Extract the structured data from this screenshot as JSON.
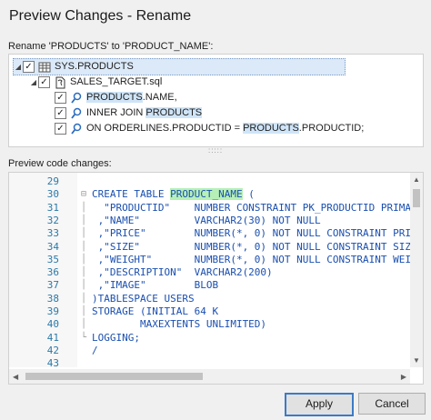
{
  "dialog": {
    "title": "Preview Changes - Rename",
    "rename_label": "Rename 'PRODUCTS' to 'PRODUCT_NAME':",
    "preview_label": "Preview code changes:"
  },
  "tree": {
    "root": {
      "label": "SYS.PRODUCTS",
      "checked": true,
      "icon": "table-icon"
    },
    "file": {
      "label": "SALES_TARGET.sql",
      "checked": true,
      "icon": "sql-file-icon"
    },
    "items": [
      {
        "pre": "",
        "match": "PRODUCTS",
        "post": ".NAME,",
        "checked": true,
        "icon": "find-reference-icon"
      },
      {
        "pre": "INNER JOIN ",
        "match": "PRODUCTS",
        "post": "",
        "checked": true,
        "icon": "find-reference-icon"
      },
      {
        "pre": "ON ORDERLINES.PRODUCTID = ",
        "match": "PRODUCTS",
        "post": ".PRODUCTID;",
        "checked": true,
        "icon": "find-reference-icon"
      }
    ]
  },
  "code": {
    "line_numbers": [
      "29",
      "30",
      "31",
      "32",
      "33",
      "34",
      "35",
      "36",
      "37",
      "38",
      "39",
      "40",
      "41",
      "42",
      "43"
    ],
    "lines": [
      "",
      "CREATE TABLE PRODUCT_NAME (",
      "  \"PRODUCTID\"    NUMBER CONSTRAINT PK_PRODUCTID PRIMA",
      " ,\"NAME\"         VARCHAR2(30) NOT NULL",
      " ,\"PRICE\"        NUMBER(*, 0) NOT NULL CONSTRAINT PRI",
      " ,\"SIZE\"         NUMBER(*, 0) NOT NULL CONSTRAINT SIZ",
      " ,\"WEIGHT\"       NUMBER(*, 0) NOT NULL CONSTRAINT WEI",
      " ,\"DESCRIPTION\"  VARCHAR2(200)",
      " ,\"IMAGE\"        BLOB",
      ")TABLESPACE USERS",
      "STORAGE (INITIAL 64 K",
      "        MAXEXTENTS UNLIMITED)",
      "LOGGING;",
      "/",
      ""
    ],
    "highlight_token": "PRODUCT_NAME"
  },
  "buttons": {
    "apply": "Apply",
    "cancel": "Cancel"
  },
  "colors": {
    "accent": "#3d7ac6",
    "keyword": "#1a4fb0",
    "highlight_green": "#b6f0b6",
    "highlight_blue": "#cfe4f7"
  }
}
